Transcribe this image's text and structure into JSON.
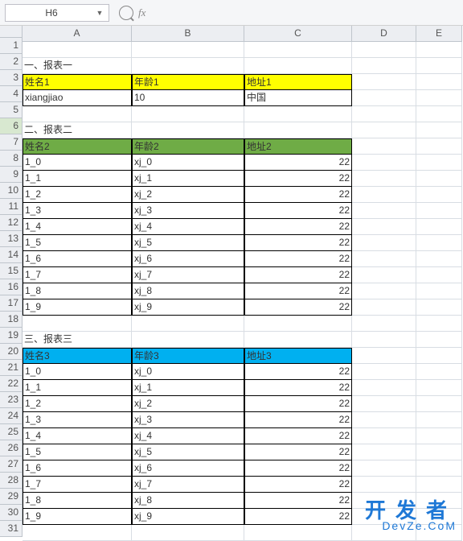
{
  "toolbar": {
    "cell_ref": "H6",
    "fx_label": "fx"
  },
  "columns": [
    "A",
    "B",
    "C",
    "D",
    "E"
  ],
  "rows": [
    "1",
    "2",
    "3",
    "4",
    "5",
    "6",
    "7",
    "8",
    "9",
    "10",
    "11",
    "12",
    "13",
    "14",
    "15",
    "16",
    "17",
    "18",
    "19",
    "20",
    "21",
    "22",
    "23",
    "24",
    "25",
    "26",
    "27",
    "28",
    "29",
    "30",
    "31"
  ],
  "selected_row": 6,
  "section1": {
    "title": "一、报表一",
    "headers": {
      "a": "姓名1",
      "b": "年龄1",
      "c": "地址1"
    },
    "rows": [
      {
        "a": "xiangjiao",
        "b": "10",
        "c": "中国"
      }
    ]
  },
  "section2": {
    "title": "二、报表二",
    "headers": {
      "a": "姓名2",
      "b": "年龄2",
      "c": "地址2"
    },
    "rows": [
      {
        "a": "1_0",
        "b": "xj_0",
        "c": "22"
      },
      {
        "a": "1_1",
        "b": "xj_1",
        "c": "22"
      },
      {
        "a": "1_2",
        "b": "xj_2",
        "c": "22"
      },
      {
        "a": "1_3",
        "b": "xj_3",
        "c": "22"
      },
      {
        "a": "1_4",
        "b": "xj_4",
        "c": "22"
      },
      {
        "a": "1_5",
        "b": "xj_5",
        "c": "22"
      },
      {
        "a": "1_6",
        "b": "xj_6",
        "c": "22"
      },
      {
        "a": "1_7",
        "b": "xj_7",
        "c": "22"
      },
      {
        "a": "1_8",
        "b": "xj_8",
        "c": "22"
      },
      {
        "a": "1_9",
        "b": "xj_9",
        "c": "22"
      }
    ]
  },
  "section3": {
    "title": "三、报表三",
    "headers": {
      "a": "姓名3",
      "b": "年龄3",
      "c": "地址3"
    },
    "rows": [
      {
        "a": "1_0",
        "b": "xj_0",
        "c": "22"
      },
      {
        "a": "1_1",
        "b": "xj_1",
        "c": "22"
      },
      {
        "a": "1_2",
        "b": "xj_2",
        "c": "22"
      },
      {
        "a": "1_3",
        "b": "xj_3",
        "c": "22"
      },
      {
        "a": "1_4",
        "b": "xj_4",
        "c": "22"
      },
      {
        "a": "1_5",
        "b": "xj_5",
        "c": "22"
      },
      {
        "a": "1_6",
        "b": "xj_6",
        "c": "22"
      },
      {
        "a": "1_7",
        "b": "xj_7",
        "c": "22"
      },
      {
        "a": "1_8",
        "b": "xj_8",
        "c": "22"
      },
      {
        "a": "1_9",
        "b": "xj_9",
        "c": "22"
      }
    ]
  },
  "watermark": {
    "cn": "开发者",
    "en": "DevZe.CoM"
  }
}
